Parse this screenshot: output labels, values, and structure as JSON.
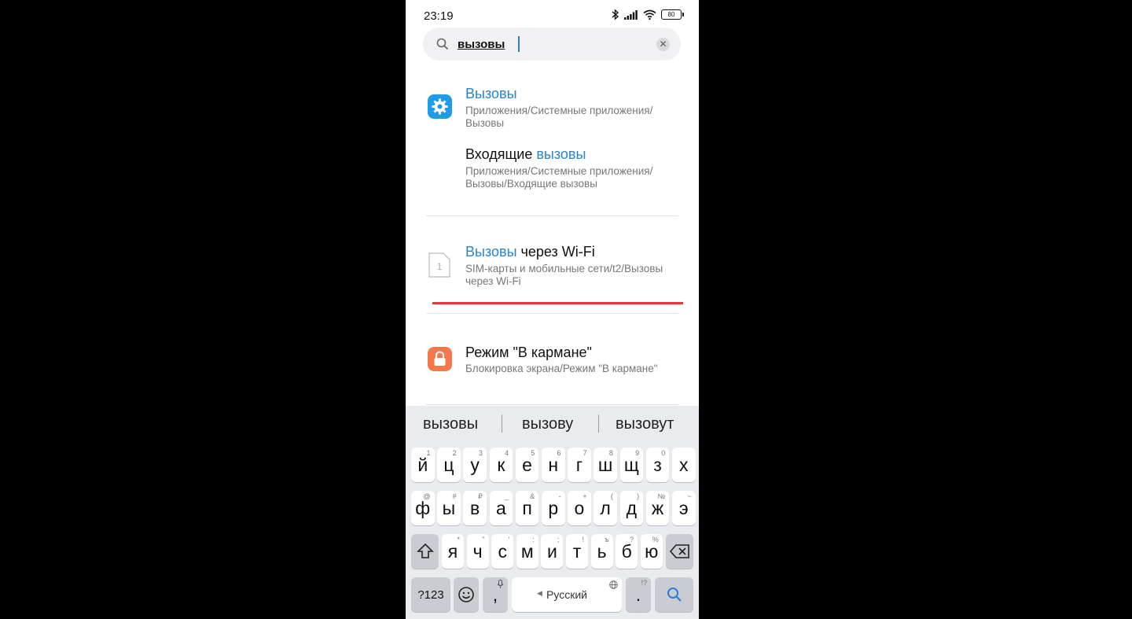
{
  "status_bar": {
    "time": "23:19",
    "battery": "80"
  },
  "search": {
    "query": "вызовы"
  },
  "results": [
    {
      "title_hl": "Вызовы",
      "title_rest": "",
      "path": "Приложения/Системные приложения/Вызовы",
      "icon": "gear-icon",
      "icon_color": "#1e9be9"
    },
    {
      "title_pre": "Входящие ",
      "title_hl": "вызовы",
      "path": "Приложения/Системные приложения/Вызовы/Входящие вызовы"
    },
    {
      "title_hl": "Вызовы",
      "title_rest": " через Wi-Fi",
      "path": "SIM-карты и мобильные сети/t2/Вызовы через Wi-Fi",
      "icon": "sim-card-icon",
      "sim_number": "1"
    },
    {
      "title_hl": "",
      "title_rest": "Режим \"В кармане\"",
      "path": "Блокировка экрана/Режим \"В кармане\"",
      "icon": "lock-icon",
      "icon_color": "#f47a4e"
    }
  ],
  "keyboard": {
    "suggestions": [
      "вызовы",
      "вызову",
      "вызовут"
    ],
    "row1": [
      [
        "й",
        "1"
      ],
      [
        "ц",
        "2"
      ],
      [
        "у",
        "3"
      ],
      [
        "к",
        "4"
      ],
      [
        "е",
        "5"
      ],
      [
        "н",
        "6"
      ],
      [
        "г",
        "7"
      ],
      [
        "ш",
        "8"
      ],
      [
        "щ",
        "9"
      ],
      [
        "з",
        "0"
      ],
      [
        "х",
        ""
      ]
    ],
    "row2": [
      [
        "ф",
        "@"
      ],
      [
        "ы",
        "#"
      ],
      [
        "в",
        "₽"
      ],
      [
        "а",
        "_"
      ],
      [
        "п",
        "&"
      ],
      [
        "р",
        "-"
      ],
      [
        "о",
        "+"
      ],
      [
        "л",
        "("
      ],
      [
        "д",
        ")"
      ],
      [
        "ж",
        "№"
      ],
      [
        "э",
        "~"
      ]
    ],
    "row3": [
      [
        "я",
        "*"
      ],
      [
        "ч",
        "\""
      ],
      [
        "с",
        "'"
      ],
      [
        "м",
        ":"
      ],
      [
        "и",
        ";"
      ],
      [
        "т",
        "!"
      ],
      [
        "ь",
        "ъ"
      ],
      [
        "б",
        "?"
      ],
      [
        "ю",
        "%"
      ]
    ],
    "symbols_label": "?123",
    "comma": ",",
    "space_label": "Русский",
    "period": ".",
    "period_alt": "!?"
  }
}
